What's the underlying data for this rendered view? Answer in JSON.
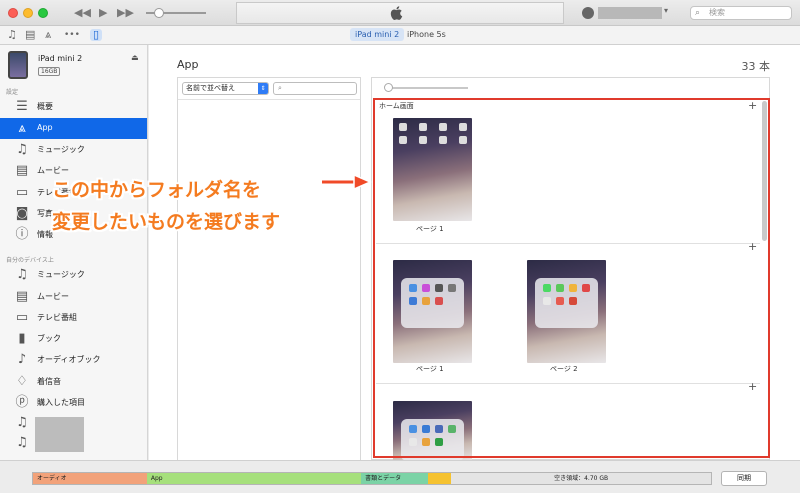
{
  "window": {
    "search_placeholder": "検索",
    "colors": {
      "selection": "#1068e8",
      "highlight_box": "#e03a2c",
      "annotation": "#f47b20"
    },
    "controls": {
      "back_icon": "rewind-icon",
      "play_icon": "play-icon",
      "forward_icon": "fast-forward-icon"
    }
  },
  "navbar": {
    "icons": [
      "music-note-icon",
      "film-icon",
      "app-store-icon",
      "more-icon",
      "iphone-icon"
    ],
    "more_label": "•••",
    "device_tabs": [
      {
        "label": "iPad mini 2",
        "selected": true
      },
      {
        "label": "iPhone 5s",
        "selected": false
      }
    ]
  },
  "sidebar": {
    "device": {
      "name": "iPad mini 2",
      "capacity": "16GB"
    },
    "settings_header": "設定",
    "settings_items": [
      {
        "label": "概要",
        "icon": "summary-icon"
      },
      {
        "label": "App",
        "icon": "app-store-icon",
        "selected": true
      },
      {
        "label": "ミュージック",
        "icon": "music-note-icon"
      },
      {
        "label": "ムービー",
        "icon": "film-icon"
      },
      {
        "label": "テレビ番組",
        "icon": "tv-icon"
      },
      {
        "label": "写真",
        "icon": "camera-icon"
      },
      {
        "label": "情報",
        "icon": "info-icon"
      }
    ],
    "ondevice_header": "自分のデバイス上",
    "ondevice_items": [
      {
        "label": "ミュージック",
        "icon": "music-note-icon"
      },
      {
        "label": "ムービー",
        "icon": "film-icon"
      },
      {
        "label": "テレビ番組",
        "icon": "tv-icon"
      },
      {
        "label": "ブック",
        "icon": "book-icon"
      },
      {
        "label": "オーディオブック",
        "icon": "audiobook-icon"
      },
      {
        "label": "着信音",
        "icon": "bell-icon"
      },
      {
        "label": "購入した項目",
        "icon": "purchased-icon"
      }
    ]
  },
  "main": {
    "title": "App",
    "count": "33 本",
    "sort_label": "名前で並べ替え",
    "home_screens_label": "ホーム画面",
    "page1_label": "ページ 1",
    "page1b_label": "ページ 1",
    "page2_label": "ページ 2"
  },
  "annotation": {
    "line1": "この中からフォルダ名を",
    "line2": "変更したいものを選びます"
  },
  "storage": {
    "segments": [
      {
        "label": "オーディオ",
        "color": "#f2a27a",
        "fraction": 0.168
      },
      {
        "label": "App",
        "color": "#a6e07c",
        "fraction": 0.316
      },
      {
        "label": "書類とデータ",
        "color": "#7bd3a6",
        "fraction": 0.098
      },
      {
        "label": "",
        "color": "#f5c230",
        "fraction": 0.035
      },
      {
        "label": "空き領域：4.70 GB",
        "color": "#e4e4e4",
        "fraction": 0.383
      }
    ],
    "sync_label": "同期"
  }
}
